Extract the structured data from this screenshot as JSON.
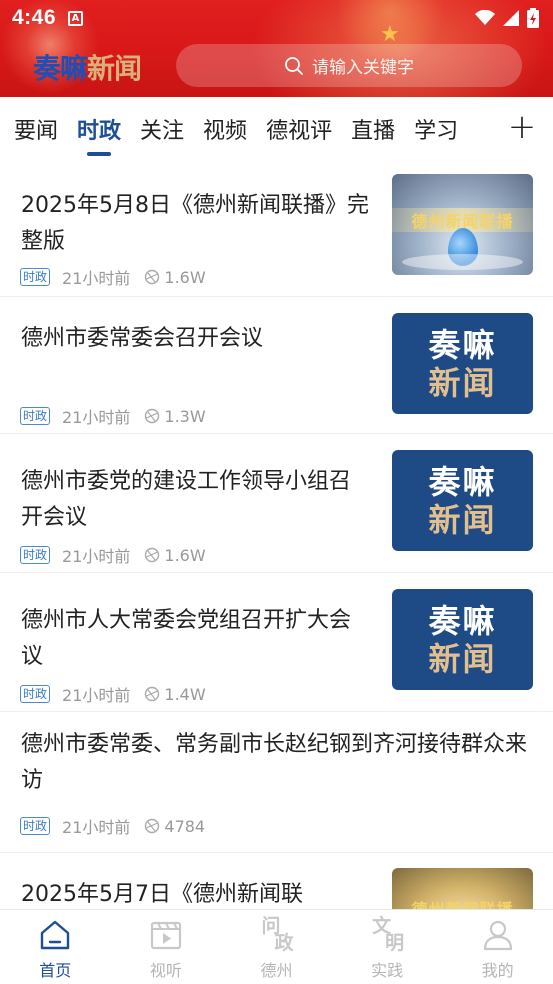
{
  "status_bar": {
    "time": "4:46",
    "notification_glyph": "A"
  },
  "header": {
    "brand_part1": "奏嘛",
    "brand_part2": "新闻",
    "search_placeholder": "请输入关键字",
    "colors": {
      "header_red": "#d81818",
      "brand_blue": "#1d4fb8",
      "brand_gold": "#d9b07a"
    }
  },
  "tabs": {
    "items": [
      "要闻",
      "时政",
      "关注",
      "视频",
      "德视评",
      "直播",
      "学习"
    ],
    "active_index": 1,
    "add_icon": "plus-icon",
    "accent": "#1c4f96"
  },
  "news": [
    {
      "title": "2025年5月8日《德州新闻联播》完整版",
      "tag": "时政",
      "time": "21小时前",
      "views": "1.6W",
      "thumb": "video",
      "thumb_text": "德州新闻联播"
    },
    {
      "title": "德州市委常委会召开会议",
      "tag": "时政",
      "time": "21小时前",
      "views": "1.3W",
      "thumb": "logo"
    },
    {
      "title": "德州市委党的建设工作领导小组召开会议",
      "tag": "时政",
      "time": "21小时前",
      "views": "1.6W",
      "thumb": "logo"
    },
    {
      "title": "德州市人大常委会党组召开扩大会议",
      "tag": "时政",
      "time": "21小时前",
      "views": "1.4W",
      "thumb": "logo"
    },
    {
      "title": "德州市委常委、常务副市长赵纪钢到齐河接待群众来访",
      "tag": "时政",
      "time": "21小时前",
      "views": "4784",
      "thumb": "none"
    },
    {
      "title": "2025年5月7日《德州新闻联",
      "thumb": "video",
      "thumb_text": "德州新闻联播"
    }
  ],
  "thumb_logo": {
    "line1": "奏嘛",
    "line2": "新闻"
  },
  "bottom_nav": {
    "items": [
      {
        "label": "首页",
        "icon": "home-icon"
      },
      {
        "label": "视听",
        "icon": "video-player-icon"
      },
      {
        "label": "德州",
        "icon": "wenzheng-icon",
        "glyph_top": "问",
        "glyph_bottom": "政"
      },
      {
        "label": "实践",
        "icon": "wenming-icon",
        "glyph_top": "文",
        "glyph_bottom": "明"
      },
      {
        "label": "我的",
        "icon": "user-icon"
      }
    ],
    "active_index": 0
  }
}
